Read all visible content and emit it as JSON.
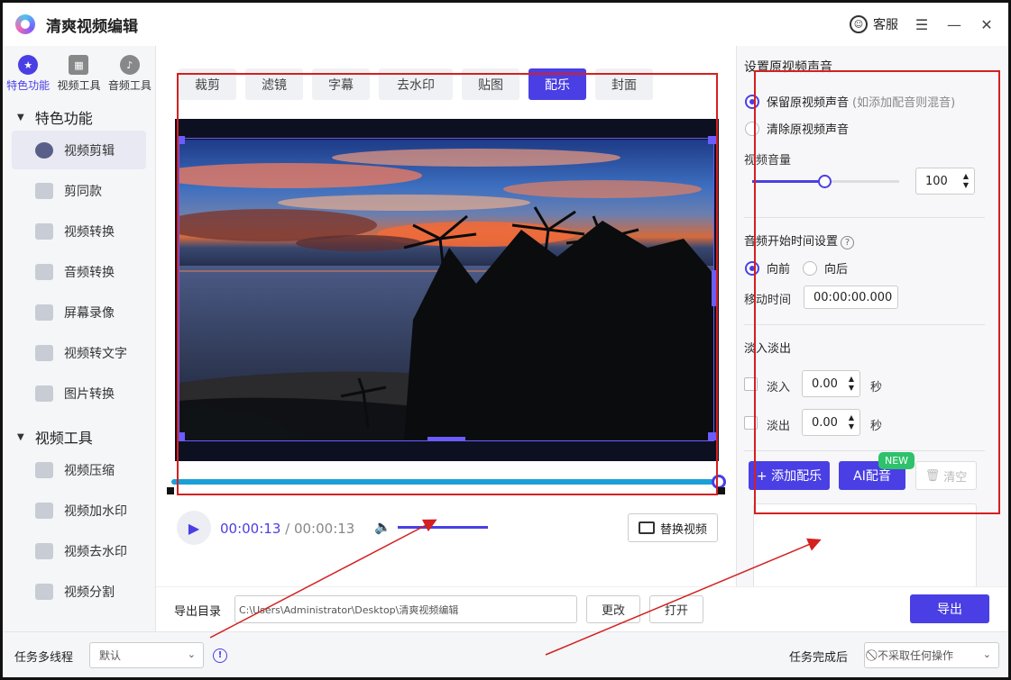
{
  "app": {
    "title": "清爽视频编辑",
    "service_label": "客服"
  },
  "sidebar": {
    "categories": [
      {
        "label": "特色功能",
        "icon": "star-icon"
      },
      {
        "label": "视频工具",
        "icon": "film-icon"
      },
      {
        "label": "音频工具",
        "icon": "music-icon"
      }
    ],
    "groups": [
      {
        "title": "特色功能",
        "items": [
          "视频剪辑",
          "剪同款",
          "视频转换",
          "音频转换",
          "屏幕录像",
          "视频转文字",
          "图片转换"
        ]
      },
      {
        "title": "视频工具",
        "items": [
          "视频压缩",
          "视频加水印",
          "视频去水印",
          "视频分割"
        ]
      }
    ]
  },
  "editor": {
    "tabs": [
      "裁剪",
      "滤镜",
      "字幕",
      "去水印",
      "贴图",
      "配乐",
      "封面"
    ],
    "active_tab": "配乐",
    "time_current": "00:00:13",
    "time_separator": " / ",
    "time_total": "00:00:13",
    "replace_video_label": "替换视频"
  },
  "audio_panel": {
    "title": "设置原视频声音",
    "keep_original": "保留原视频声音",
    "keep_hint": "(如添加配音则混音)",
    "clear_original": "清除原视频声音",
    "volume_label": "视频音量",
    "volume_value": "100",
    "volume_fraction": 0.5,
    "start_time_title": "音频开始时间设置",
    "direction_forward": "向前",
    "direction_backward": "向后",
    "move_time_label": "移动时间",
    "move_time_value": "00:00:00.000",
    "fade_title": "淡入淡出",
    "fade_in_label": "淡入",
    "fade_in_value": "0.00",
    "fade_out_label": "淡出",
    "fade_out_value": "0.00",
    "seconds_unit": "秒",
    "add_music_label": "+ 添加配乐",
    "ai_dub_label": "AI配音",
    "new_badge": "NEW",
    "clear_label": "清空"
  },
  "export": {
    "dir_label": "导出目录",
    "dir_value": "C:\\Users\\Administrator\\Desktop\\清爽视频编辑",
    "change_label": "更改",
    "open_label": "打开",
    "export_label": "导出"
  },
  "status_bar": {
    "threads_label": "任务多线程",
    "threads_value": "默认",
    "after_done_label": "任务完成后",
    "after_done_value": "不采取任何操作"
  },
  "colors": {
    "accent": "#4a3fe4",
    "timeline": "#1aa0d6",
    "annotation": "#d42020",
    "new_badge": "#2dc26b"
  }
}
